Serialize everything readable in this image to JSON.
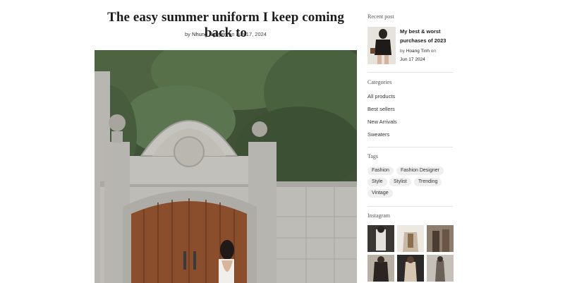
{
  "post": {
    "title": "The easy summer uniform I keep coming back to",
    "by_prefix": "by",
    "author": "Nhung Nguyen",
    "on_word": "on",
    "date": "Jun 17, 2024"
  },
  "sidebar": {
    "recent_heading": "Recent post",
    "recent_post": {
      "title": "My best & worst purchases of 2023",
      "by_prefix": "by",
      "author": "Hoang Tinh",
      "on_word": "on",
      "date": "Jun 17 2024"
    },
    "categories_heading": "Categories",
    "categories": [
      "All products",
      "Best sellers",
      "New Arrivals",
      "Sweaters"
    ],
    "tags_heading": "Tags",
    "tags": [
      "Fashion",
      "Fashion Designer",
      "Style",
      "Stylist",
      "Trending",
      "Vintage"
    ],
    "instagram_heading": "Instagram"
  },
  "colors": {
    "accent_text": "#1c1c1c",
    "tag_background": "#efefef",
    "divider": "#e2e2e2"
  }
}
